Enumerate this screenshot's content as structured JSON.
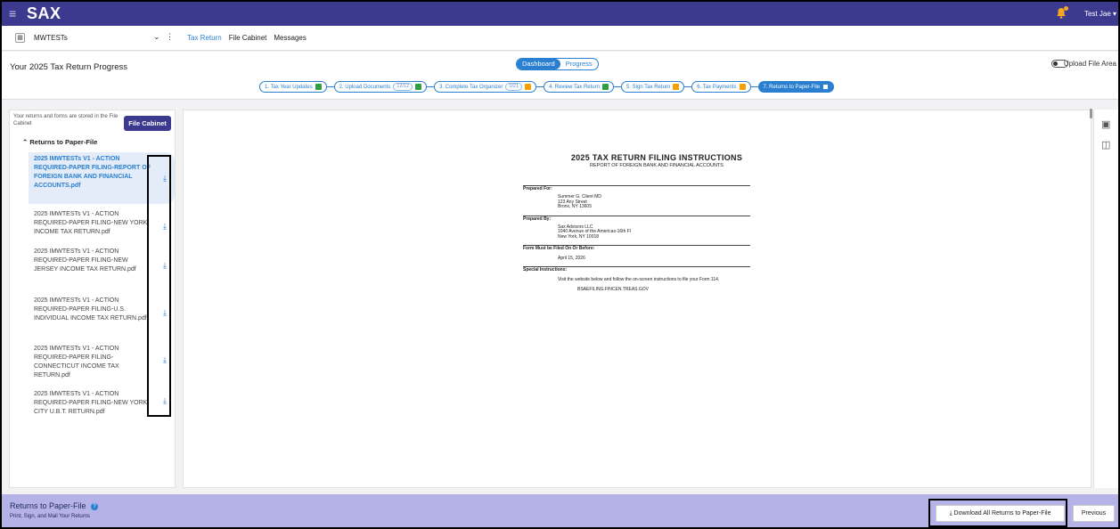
{
  "header": {
    "menu_icon": "hamburger-icon",
    "logo": "SAX",
    "notification_icon": "bell-icon",
    "user_menu": "Test Jae ▾"
  },
  "entity": {
    "icon": "building-icon",
    "name": "MWTESTs",
    "chevron": "⌄",
    "more": "⋮"
  },
  "topnav": {
    "items": [
      "Tax Return",
      "File Cabinet",
      "Messages"
    ],
    "active": "Tax Return"
  },
  "progress": {
    "title": "Your 2025 Tax Return Progress",
    "toggle": {
      "dashboard": "Dashboard",
      "progress": "Progress",
      "selected": "Progress"
    },
    "upload_area_label": "Upload File Area",
    "upload_area_on": false,
    "steps": [
      {
        "label": "1. Tax Year Updates",
        "count": "",
        "indicator": "complete",
        "indicator_color": "#2f9e44"
      },
      {
        "label": "2. Upload Documents",
        "count": "12/12",
        "indicator": "complete",
        "indicator_color": "#2f9e44"
      },
      {
        "label": "3. Complete Tax Organizer",
        "count": "0/21",
        "indicator": "warning",
        "indicator_color": "#f59f00"
      },
      {
        "label": "4. Review Tax Return",
        "count": "",
        "indicator": "complete",
        "indicator_color": "#2f9e44"
      },
      {
        "label": "5. Sign Tax Return",
        "count": "",
        "indicator": "warning",
        "indicator_color": "#f59f00"
      },
      {
        "label": "6. Tax Payments",
        "count": "",
        "indicator": "warning",
        "indicator_color": "#f59f00"
      },
      {
        "label": "7. Returns to Paper-File",
        "count": "",
        "indicator": "current",
        "indicator_color": "#ffffff"
      }
    ]
  },
  "left_panel": {
    "note": "Your returns and forms are stored in the File Cabinet",
    "file_cabinet_button": "File Cabinet",
    "section_title": "Returns to Paper-File",
    "section_chevron": "^",
    "download_icon": "download-icon",
    "files": [
      "2025 IMWTESTs V1 - ACTION REQUIRED-PAPER FILING-REPORT OF FOREIGN BANK AND FINANCIAL ACCOUNTS.pdf",
      "2025 IMWTESTs V1 - ACTION REQUIRED-PAPER FILING-NEW YORK INCOME TAX RETURN.pdf",
      "2025 IMWTESTs V1 - ACTION REQUIRED-PAPER FILING-NEW JERSEY INCOME TAX RETURN.pdf",
      "2025 IMWTESTs V1 - ACTION REQUIRED-PAPER FILING-U.S. INDIVIDUAL INCOME TAX RETURN.pdf",
      "2025 IMWTESTs V1 - ACTION REQUIRED-PAPER FILING-CONNECTICUT INCOME TAX RETURN.pdf",
      "2025 IMWTESTs V1 - ACTION REQUIRED-PAPER FILING-NEW YORK CITY U.B.T. RETURN.pdf"
    ],
    "selected_index": 0
  },
  "document": {
    "title": "2025 TAX RETURN FILING INSTRUCTIONS",
    "subtitle": "REPORT OF FOREIGN BANK AND FINANCIAL ACCOUNTS",
    "prepared_for_label": "Prepared For:",
    "prepared_for": [
      "Summer G. Client MD",
      "123 Any Street",
      "Bronx, NY  13605"
    ],
    "prepared_by_label": "Prepared By:",
    "prepared_by": [
      "Sax Advisors LLC",
      "1040 Avenue of the Americas-16th Fl",
      "New York, NY  10018"
    ],
    "due_label": "Form Must be Filed On Or Before:",
    "due_date": "April 15, 2026",
    "special_label": "Special Instructions:",
    "special_text": "Visit the website below and follow the on-screen instructions to file your Form 114.",
    "website": "BSAEFILING.FINCEN.TREAS.GOV"
  },
  "rail": {
    "icons": [
      "fit-to-page-icon",
      "fit-to-width-icon"
    ]
  },
  "bottom": {
    "title": "Returns to Paper-File",
    "help_icon": "help-icon",
    "subtitle": "Print, Sign, and Mail Your Returns",
    "download_all": "Download All Returns to Paper-File",
    "previous": "Previous"
  }
}
